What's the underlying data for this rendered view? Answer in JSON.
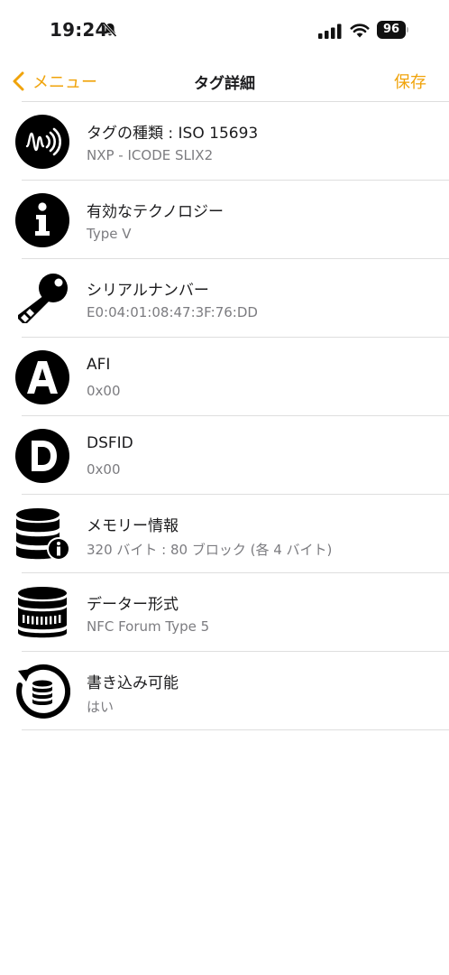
{
  "status": {
    "time": "19:24",
    "battery": "96"
  },
  "nav": {
    "back_label": "メニュー",
    "title": "タグ詳細",
    "save_label": "保存"
  },
  "rows": [
    {
      "icon": "nfc-tag-icon",
      "title": "タグの種類 : ISO 15693",
      "subtitle": "NXP - ICODE SLIX2"
    },
    {
      "icon": "info-icon",
      "title": "有効なテクノロジー",
      "subtitle": "Type V"
    },
    {
      "icon": "key-icon",
      "title": "シリアルナンバー",
      "subtitle": "E0:04:01:08:47:3F:76:DD"
    },
    {
      "icon": "letter-a-icon",
      "title": "AFI",
      "subtitle": "0x00"
    },
    {
      "icon": "letter-d-icon",
      "title": "DSFID",
      "subtitle": "0x00"
    },
    {
      "icon": "database-info-icon",
      "title": "メモリー情報",
      "subtitle": "320 バイト : 80 ブロック (各 4 バイト)"
    },
    {
      "icon": "database-format-icon",
      "title": "データー形式",
      "subtitle": "NFC Forum Type 5"
    },
    {
      "icon": "database-writable-icon",
      "title": "書き込み可能",
      "subtitle": "はい"
    }
  ],
  "colors": {
    "accent": "#f0a30a",
    "text": "#1c1c1e",
    "secondary": "#7c7c80",
    "separator": "#dedede"
  }
}
